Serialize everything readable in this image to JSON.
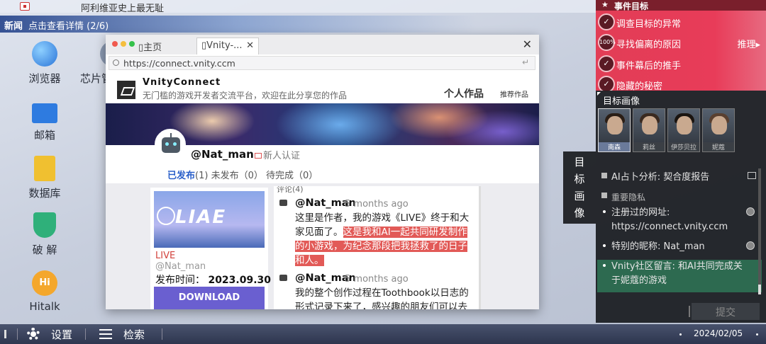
{
  "ticker": {
    "text": "阿利维亚史上最无耻"
  },
  "news": {
    "tag": "新闻",
    "text": "点击查看详情 (2/6)"
  },
  "desktop": {
    "icons": [
      {
        "label": "浏览器",
        "icon": "globe-icon"
      },
      {
        "label": "芯片管",
        "icon": "chip-icon"
      },
      {
        "label": "邮箱",
        "icon": "mail-icon"
      },
      {
        "label": "数据库",
        "icon": "database-icon"
      },
      {
        "label": "破 解",
        "icon": "shield-lock-icon"
      },
      {
        "label": "Hitalk",
        "icon": "hitalk-icon"
      }
    ]
  },
  "browser": {
    "tabs": [
      {
        "label": "主页"
      },
      {
        "label": "Vnity-..."
      }
    ],
    "close_label": "✕",
    "tab_close": "✕",
    "url": "https://connect.vnity.ccm",
    "site": {
      "brand": "VnityConnect",
      "subtitle": "无门槛的游戏开发者交流平台，欢迎在此分享您的作品",
      "my_works": "个人作品",
      "recommended": "推荐作品"
    },
    "profile": {
      "username": "@Nat_man",
      "cert": "新人认证",
      "tab_published": "已发布",
      "tab_published_count": "(1)",
      "tab_unpublished": "未发布（0）",
      "tab_pending": "待完成（0）"
    },
    "game": {
      "logo_text": "LIAE",
      "title": "LIVE",
      "author": "@Nat_man",
      "date_label": "发布时间：",
      "date": "2023.09.30",
      "download": "DOWNLOAD"
    },
    "comments": {
      "header": "评论(4)",
      "items": [
        {
          "user": "@Nat_man",
          "time": "5 months ago",
          "text_plain": "这里是作者，我的游戏《LIVE》终于和大家见面了。",
          "text_highlight": "这是我和AI一起共同研发制作的小游戏，为纪念那段把我拯救了的日子和人。"
        },
        {
          "user": "@Nat_man",
          "time": "5 months ago",
          "text_plain": "我的整个创作过程在Toothbook以日志的形式记录下来了，感兴趣的朋友们可以去",
          "text_highlight": ""
        }
      ]
    }
  },
  "events": {
    "title": "事件目标",
    "items": [
      {
        "label": "调查目标的异常",
        "badge": "✓"
      },
      {
        "label": "寻找偏离的原因",
        "badge": "100%",
        "action": "推理▸"
      },
      {
        "label": "事件幕后的推手",
        "badge": "✓"
      },
      {
        "label": "隐藏的秘密",
        "badge": "✓"
      }
    ]
  },
  "portraits": {
    "title": "目标画像",
    "people": [
      {
        "name": "南森"
      },
      {
        "name": "莉丝"
      },
      {
        "name": "伊莎贝拉"
      },
      {
        "name": "妮蔻"
      }
    ],
    "info": {
      "ai_analysis": "AI占卜分析: 契合度报告",
      "secret_title": "重要隐私",
      "items": [
        {
          "text": "注册过的网址: https://connect.vnity.ccm"
        },
        {
          "text": "特别的昵称: Nat_man"
        },
        {
          "text": "Vnity社区留言: 和AI共同完成关于妮蔻的游戏"
        }
      ]
    },
    "submit": "提交",
    "side_tab": "目标画像"
  },
  "taskbar": {
    "settings": "设置",
    "search": "检索",
    "date": "2024/02/05"
  },
  "colors": {
    "event_red": "#e23d56",
    "download_purple": "#6a5fd0",
    "highlight_red": "#e25a57",
    "taskbar": "#283250"
  }
}
